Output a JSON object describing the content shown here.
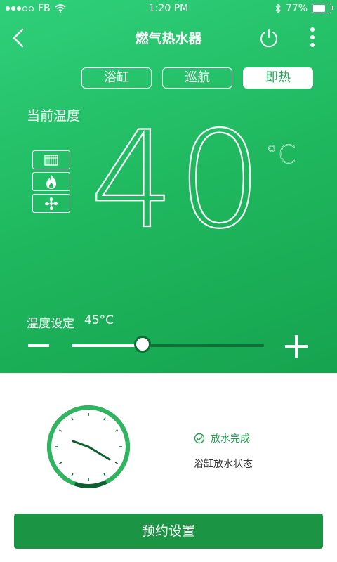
{
  "status_bar": {
    "carrier": "FB",
    "time": "1:20 PM",
    "battery": "77%",
    "battery_level": 0.77
  },
  "header": {
    "title": "燃气热水器",
    "back_icon": "back-chevron-icon",
    "power_icon": "power-icon",
    "more_icon": "more-vertical-icon"
  },
  "modes": [
    {
      "label": "浴缸",
      "active": false
    },
    {
      "label": "巡航",
      "active": false
    },
    {
      "label": "即热",
      "active": true
    }
  ],
  "current": {
    "label": "当前温度",
    "value": "40",
    "unit": "°C"
  },
  "indicators": [
    "heater-grille-icon",
    "flame-icon",
    "fan-icon"
  ],
  "setpoint": {
    "label": "温度设定",
    "value": "45°C",
    "slider_fraction": 0.37
  },
  "bath": {
    "status_title": "放水完成",
    "status_desc": "浴缸放水状态",
    "progress_fraction": 0.87
  },
  "schedule_button": "预约设置",
  "colors": {
    "primary": "#1faa55",
    "dark_green": "#0f6f37",
    "button_green": "#1b9544"
  }
}
